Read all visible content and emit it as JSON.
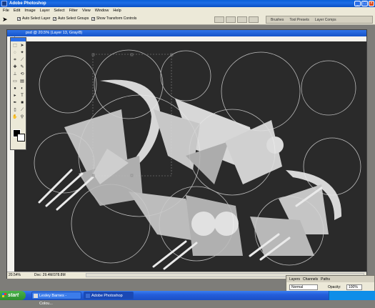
{
  "window": {
    "title": "Adobe Photoshop",
    "minimize": "_",
    "maximize": "□",
    "close": "×"
  },
  "menu": [
    "File",
    "Edit",
    "Image",
    "Layer",
    "Select",
    "Filter",
    "View",
    "Window",
    "Help"
  ],
  "options": {
    "auto_select_layer": {
      "label": "Auto Select Layer",
      "checked": true
    },
    "auto_select_groups": {
      "label": "Auto Select Groups",
      "checked": true
    },
    "show_transform": {
      "label": "Show Transform Controls",
      "checked": true
    }
  },
  "palette_well": [
    "Brushes",
    "Tool Presets",
    "Layer Comps"
  ],
  "document": {
    "title": "psd @ 20.5% (Layer 13, Gray/8)",
    "zoom": "20.54%",
    "doc_size": "Doc: 29.4M/378.8M"
  },
  "layers_panel": {
    "tabs": [
      "Layers",
      "Channels",
      "Paths"
    ],
    "blend_mode": "Normal",
    "opacity_label": "Opacity:",
    "opacity_value": "100%"
  },
  "taskbar": {
    "start": "start",
    "tasks": [
      "Lesley Barnes - Colou...",
      "Adobe Photoshop"
    ]
  },
  "colors": {
    "canvas": "#2a2a2a",
    "xp_blue": "#245edb",
    "start_green": "#2d8f2d"
  }
}
